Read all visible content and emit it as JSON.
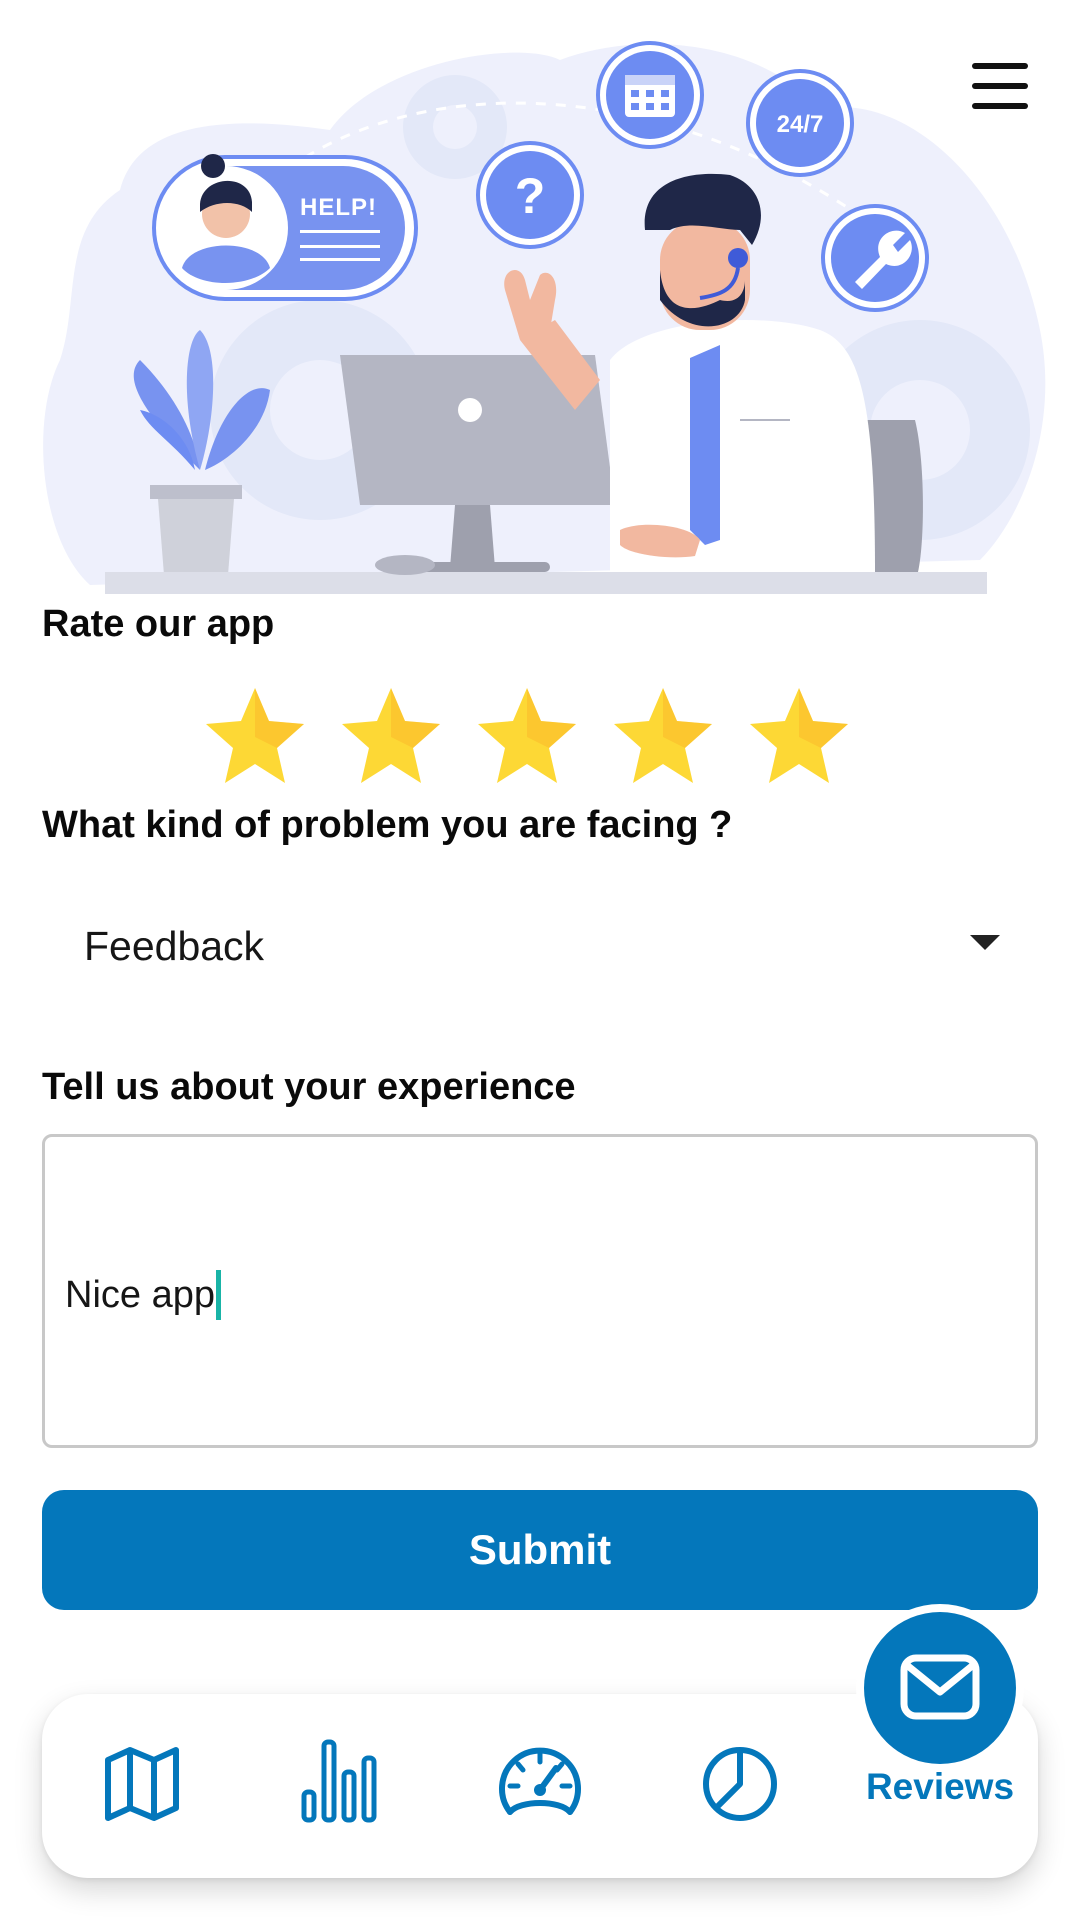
{
  "illustration": {
    "help_bubble_text": "HELP!",
    "badge_24_7": "24/7",
    "question_mark": "?"
  },
  "header": {
    "menu_icon": "hamburger-menu-icon"
  },
  "rating": {
    "title": "Rate our app",
    "value": 5,
    "max": 5,
    "star_color": "#FDD835"
  },
  "problem": {
    "title": "What kind of problem you are facing ?",
    "selected": "Feedback"
  },
  "experience": {
    "title": "Tell us about your experience",
    "value": "Nice app"
  },
  "submit_label": "Submit",
  "bottom_nav": {
    "items": [
      {
        "icon": "map-icon"
      },
      {
        "icon": "bar-chart-icon"
      },
      {
        "icon": "speedometer-icon"
      },
      {
        "icon": "pie-chart-icon"
      },
      {
        "icon": "envelope-icon",
        "label": "Reviews",
        "active": true
      }
    ]
  },
  "colors": {
    "primary": "#0477BB",
    "cursor": "#19B4A7",
    "illustration_blue": "#6D8CF2"
  }
}
